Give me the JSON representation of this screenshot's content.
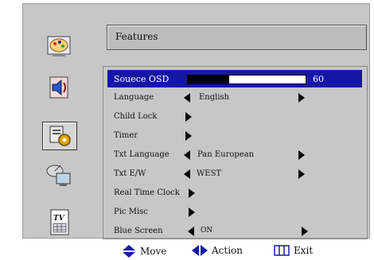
{
  "panel": {
    "title": "Features"
  },
  "sidebar": {
    "icons": [
      "picture-icon",
      "sound-icon",
      "features-icon",
      "satellite-icon",
      "tv-guide-icon"
    ],
    "tv_badge": "TV",
    "selected": "features-icon"
  },
  "menu": {
    "source_osd": {
      "label": "Souece OSD",
      "value": "60",
      "level_percent": 35
    },
    "language": {
      "label": "Language",
      "value": "English"
    },
    "child_lock": {
      "label": "Child Lock"
    },
    "timer": {
      "label": "Timer"
    },
    "txt_language": {
      "label": "Txt Language",
      "value": "Pan European"
    },
    "txt_ew": {
      "label": "Txt E/W",
      "value": "WEST"
    },
    "real_time_clock": {
      "label": "Real Time Clock"
    },
    "pic_misc": {
      "label": "Pic Misc"
    },
    "blue_screen": {
      "label": "Blue Screen",
      "value": "ON"
    }
  },
  "footer": {
    "move": "Move",
    "action": "Action",
    "exit": "Exit"
  },
  "colors": {
    "highlight": "#1616a6",
    "panel": "#c7c7c7",
    "footer_icon": "#1a1aa8"
  }
}
